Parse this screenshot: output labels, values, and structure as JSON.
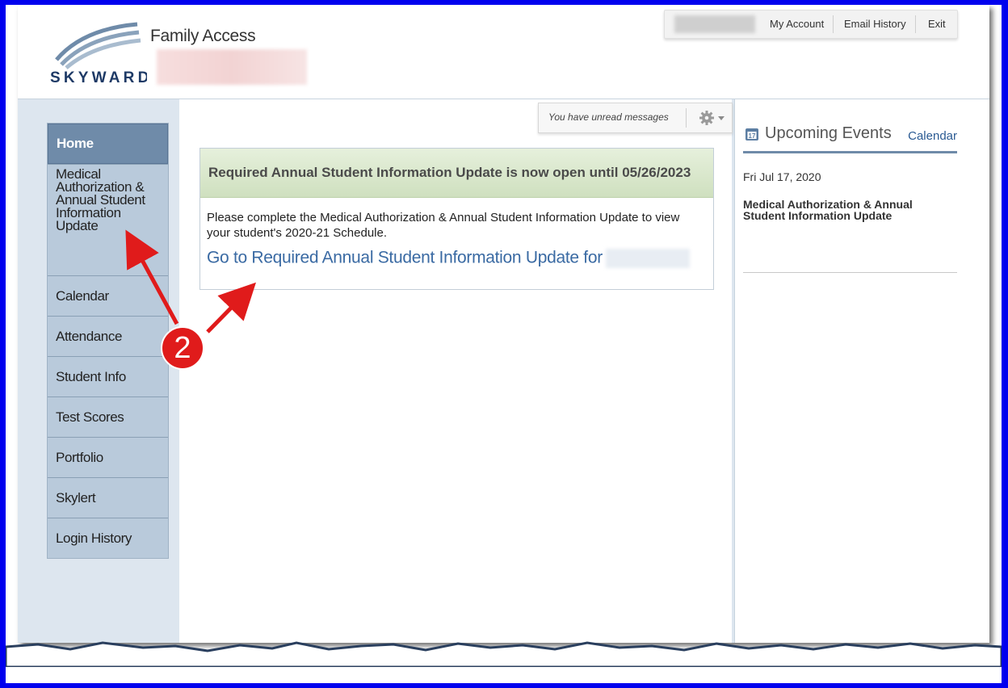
{
  "header": {
    "app_title": "Family Access",
    "logo_text": "SKYWARD",
    "links": [
      "My Account",
      "Email History",
      "Exit"
    ]
  },
  "nav": {
    "items": [
      {
        "label": "Home",
        "active": true
      },
      {
        "label": "Medical Authorization & Annual Student Information Update",
        "lines": [
          "Medical",
          "Authorization &",
          "Annual Student",
          "Information",
          "Update"
        ]
      },
      {
        "label": "Calendar"
      },
      {
        "label": "Attendance"
      },
      {
        "label": "Student Info"
      },
      {
        "label": "Test Scores"
      },
      {
        "label": "Portfolio"
      },
      {
        "label": "Skylert"
      },
      {
        "label": "Login History"
      }
    ]
  },
  "messages": {
    "text": "You have unread messages",
    "icon": "gear-icon"
  },
  "notice": {
    "title": "Required Annual Student Information Update is now open until 05/26/2023",
    "body": "Please complete the Medical Authorization & Annual Student Information Update to view your student's 2020-21 Schedule.",
    "link": "Go to Required Annual Student Information Update for"
  },
  "events": {
    "title": "Upcoming Events",
    "calendar_link": "Calendar",
    "items": [
      {
        "date": "Fri Jul 17, 2020",
        "title": "Medical Authorization & Annual Student Information Update"
      }
    ]
  },
  "annotation": {
    "number": "2",
    "color": "#e01b1b"
  },
  "colors": {
    "frame": "#0000ee",
    "nav_active": "#6f8ba9",
    "nav_item": "#b9cadb",
    "notice_header": "#d6e5c8",
    "link": "#3a6aa3"
  }
}
